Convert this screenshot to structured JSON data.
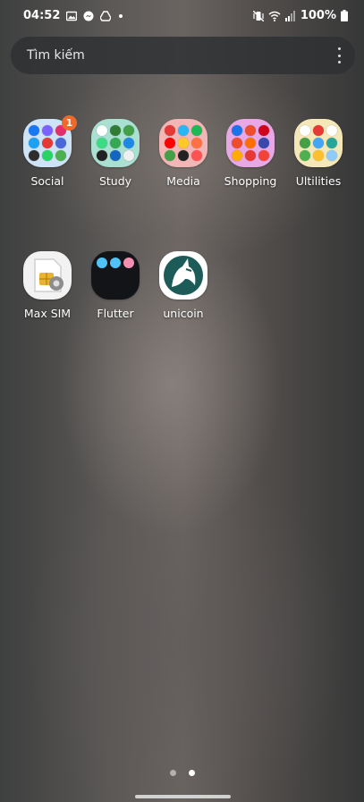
{
  "status_bar": {
    "time": "04:52",
    "battery": "100%",
    "left_icons": [
      "gallery-icon",
      "messenger-icon",
      "drive-icon",
      "notification-dot"
    ],
    "right_icons": [
      "mute-vibrate-icon",
      "wifi-icon",
      "signal-icon",
      "battery-icon"
    ]
  },
  "search": {
    "placeholder": "Tìm kiếm",
    "menu_icon": "more-vert-icon"
  },
  "apps_row1": [
    {
      "label": "Social",
      "type": "folder",
      "badge": "1",
      "tile_color": "#cfe3f6",
      "icon_colors": [
        "#1877f2",
        "#7b61ff",
        "#e1306c",
        "#1da1f2",
        "#e53935",
        "#4a68d6",
        "#2d2d2d",
        "#25d366",
        "#4caf50"
      ]
    },
    {
      "label": "Study",
      "type": "folder",
      "tile_color": "#a9e0d2",
      "icon_colors": [
        "#ffffff",
        "#2e7d32",
        "#43a047",
        "#3ddc84",
        "#34a853",
        "#1e88e5",
        "#222222",
        "#1565c0",
        "#f0f0f0"
      ]
    },
    {
      "label": "Media",
      "type": "folder",
      "tile_color": "#f3b6b6",
      "icon_colors": [
        "#e53935",
        "#29b6f6",
        "#1db954",
        "#ff0000",
        "#ffca28",
        "#ff7043",
        "#43a047",
        "#222222",
        "#ff5252"
      ]
    },
    {
      "label": "Shopping",
      "type": "folder",
      "tile_color": "#e8a8e6",
      "icon_colors": [
        "#1a73e8",
        "#ee4d2d",
        "#d0011b",
        "#ee4d2d",
        "#ff6f00",
        "#3949ab",
        "#ffab00",
        "#e53935",
        "#f44336"
      ]
    },
    {
      "label": "Ultilities",
      "type": "folder",
      "tile_color": "#f5e8b8",
      "icon_colors": [
        "#ffffff",
        "#e53935",
        "#ffffff",
        "#43a047",
        "#42a5f5",
        "#26a69a",
        "#4caf50",
        "#fbc02d",
        "#90caf9"
      ]
    }
  ],
  "apps_row2": [
    {
      "label": "Max SIM",
      "type": "app",
      "tile_color": "#f2f2f2"
    },
    {
      "label": "Flutter",
      "type": "folder",
      "tile_color": "#121417",
      "icon_colors": [
        "#4fc3f7",
        "#4fc3f7",
        "#f48fb1"
      ]
    },
    {
      "label": "unicoin",
      "type": "app",
      "tile_color": "#ffffff",
      "accent": "#1c5b57"
    }
  ],
  "pager": {
    "pages": 2,
    "current": 2
  }
}
